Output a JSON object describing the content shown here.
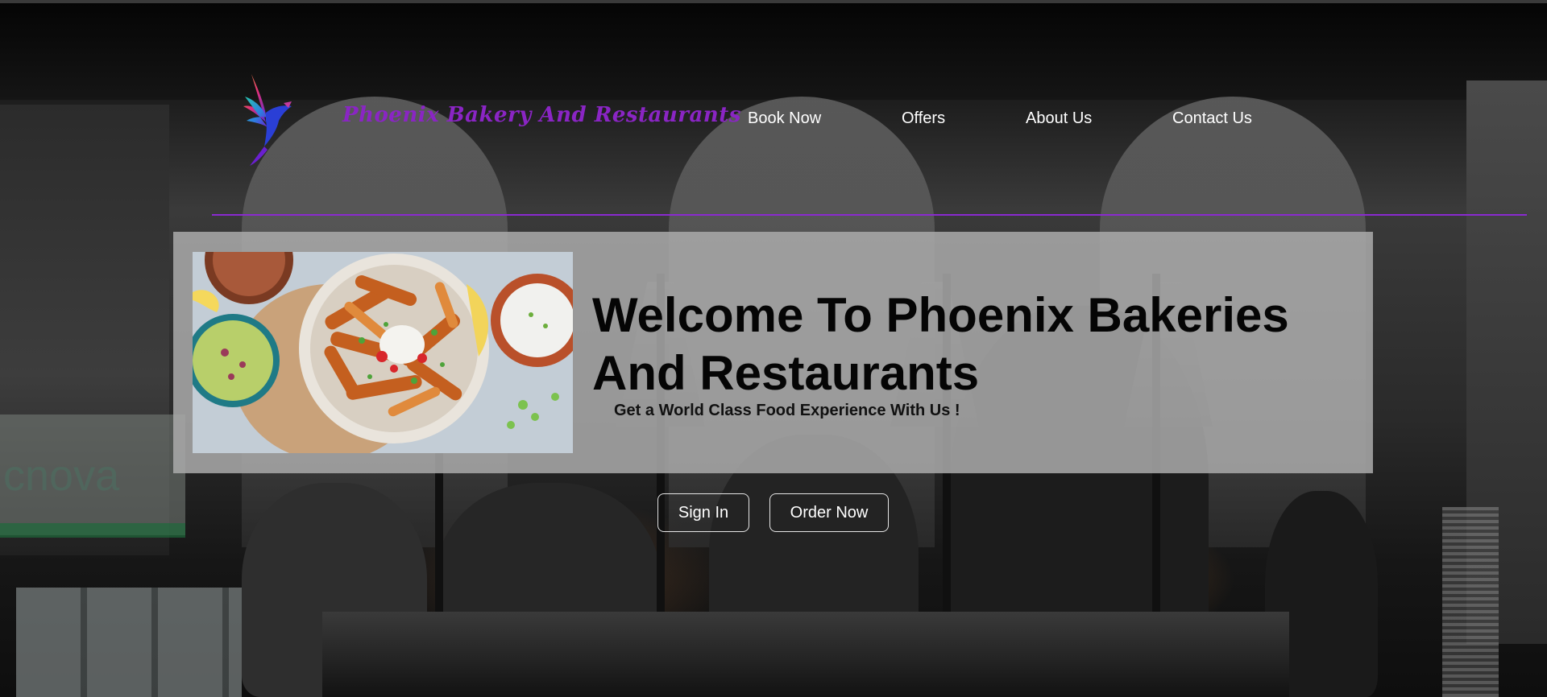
{
  "brand": {
    "name": "Phoenix Bakery And Restaurants",
    "logo_icon": "phoenix-bird-icon",
    "brand_color": "#8a25c4"
  },
  "nav": {
    "items": [
      {
        "label": "Book Now"
      },
      {
        "label": "Offers"
      },
      {
        "label": "About Us"
      },
      {
        "label": "Contact Us"
      }
    ],
    "divider_color": "#8a2ad0"
  },
  "hero": {
    "title": "Welcome To Phoenix Bakeries And Restaurants",
    "subtitle": "Get a World Class Food Experience With Us !",
    "image": "food-plate-image"
  },
  "actions": {
    "sign_in": "Sign In",
    "order_now": "Order Now"
  },
  "background": {
    "sign_text": "cnova"
  }
}
